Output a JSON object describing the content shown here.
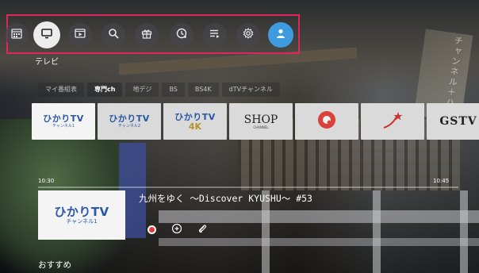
{
  "topbar": {
    "items": [
      {
        "name": "calendar-icon",
        "active": false
      },
      {
        "name": "tv-icon",
        "active": true
      },
      {
        "name": "video-library-icon",
        "active": false
      },
      {
        "name": "search-icon",
        "active": false
      },
      {
        "name": "gift-icon",
        "active": false
      },
      {
        "name": "history-icon",
        "active": false
      },
      {
        "name": "playlist-icon",
        "active": false
      },
      {
        "name": "gear-icon",
        "active": false
      },
      {
        "name": "user-icon",
        "active": false
      }
    ],
    "active_label": "テレビ",
    "highlight_color": "#e0245e",
    "profile_color": "#3e9be0"
  },
  "tabs": [
    "マイ番組表",
    "専門ch",
    "地デジ",
    "BS",
    "BS4K",
    "dTVチャンネル"
  ],
  "selected_tab": "専門ch",
  "channels": [
    {
      "logo": "ひかりTV",
      "sub": "チャンネル1",
      "kind": "hikari"
    },
    {
      "logo": "ひかりTV",
      "sub": "チャンネル2",
      "kind": "hikari"
    },
    {
      "logo": "ひかりTV",
      "sub": "4K",
      "kind": "hikari4k"
    },
    {
      "logo": "SHOP",
      "sub": "CHANNEL",
      "kind": "shop"
    },
    {
      "logo": "QVC",
      "sub": "",
      "kind": "qvc"
    },
    {
      "logo": "",
      "sub": "",
      "kind": "jewelry"
    },
    {
      "logo": "GSTV",
      "sub": "",
      "kind": "gstv"
    }
  ],
  "program": {
    "start_time": "10:30",
    "end_time": "10:45",
    "progress": 0.0,
    "channel_logo": "ひかりTV",
    "channel_sub": "チャンネル1",
    "title": "九州をゆく ～Discover KYUSHU～  #53"
  },
  "section_title": "おすすめ",
  "background_sign_text": "チャンネル＋ハガ"
}
